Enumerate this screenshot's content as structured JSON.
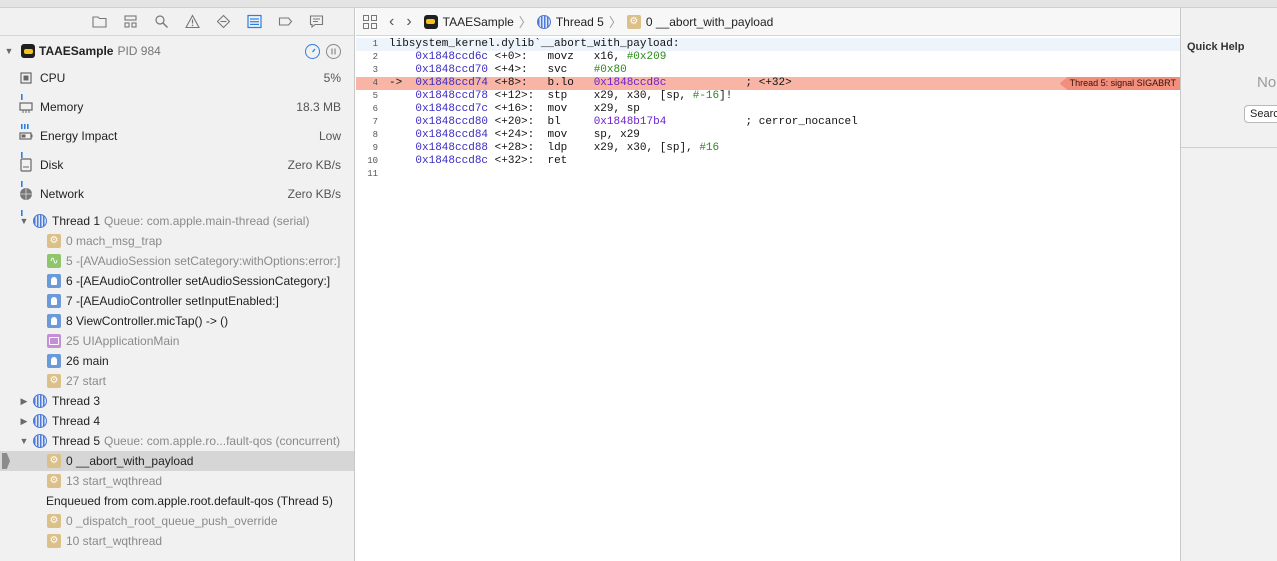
{
  "process": {
    "name": "TAAESample",
    "pid": "PID 984"
  },
  "gauges": [
    {
      "name": "cpu",
      "label": "CPU",
      "value": "5%"
    },
    {
      "name": "memory",
      "label": "Memory",
      "value": "18.3 MB"
    },
    {
      "name": "energy",
      "label": "Energy Impact",
      "value": "Low"
    },
    {
      "name": "disk",
      "label": "Disk",
      "value": "Zero KB/s"
    },
    {
      "name": "network",
      "label": "Network",
      "value": "Zero KB/s"
    }
  ],
  "tree": [
    {
      "kind": "thread",
      "expanded": true,
      "label": "Thread 1",
      "sub": "Queue: com.apple.main-thread (serial)"
    },
    {
      "kind": "frame",
      "icon": "gear",
      "dim": true,
      "label": "0 mach_msg_trap"
    },
    {
      "kind": "frame",
      "icon": "wave",
      "dim": true,
      "label": "5 -[AVAudioSession setCategory:withOptions:error:]"
    },
    {
      "kind": "frame",
      "icon": "user",
      "dim": false,
      "label": "6 -[AEAudioController setAudioSessionCategory:]"
    },
    {
      "kind": "frame",
      "icon": "user",
      "dim": false,
      "label": "7 -[AEAudioController setInputEnabled:]"
    },
    {
      "kind": "frame",
      "icon": "user",
      "dim": false,
      "label": "8 ViewController.micTap() -> ()"
    },
    {
      "kind": "frame",
      "icon": "app",
      "dim": true,
      "label": "25 UIApplicationMain"
    },
    {
      "kind": "frame",
      "icon": "user",
      "dim": false,
      "label": "26 main"
    },
    {
      "kind": "frame",
      "icon": "gear",
      "dim": true,
      "label": "27 start"
    },
    {
      "kind": "thread",
      "expanded": false,
      "label": "Thread 3",
      "sub": ""
    },
    {
      "kind": "thread",
      "expanded": false,
      "label": "Thread 4",
      "sub": ""
    },
    {
      "kind": "thread",
      "expanded": true,
      "label": "Thread 5",
      "sub": "Queue: com.apple.ro...fault-qos (concurrent)"
    },
    {
      "kind": "frame",
      "icon": "gear",
      "dim": false,
      "selected": true,
      "label": "0 __abort_with_payload"
    },
    {
      "kind": "frame",
      "icon": "gear",
      "dim": true,
      "label": "13 start_wqthread"
    },
    {
      "kind": "text",
      "label": "Enqueued from com.apple.root.default-qos (Thread 5)"
    },
    {
      "kind": "frame",
      "icon": "gear",
      "dim": true,
      "label": "0 _dispatch_root_queue_push_override"
    },
    {
      "kind": "frame",
      "icon": "gear",
      "dim": true,
      "label": "10 start_wqthread"
    }
  ],
  "jumpbar": {
    "app": "TAAESample",
    "thread": "Thread 5",
    "frame": "0 __abort_with_payload"
  },
  "code": {
    "header": "libsystem_kernel.dylib`__abort_with_payload:",
    "lines": [
      {
        "n": "1",
        "header": true
      },
      {
        "n": "2",
        "addr": "0x1848ccd6c",
        "off": "<+0>:",
        "op": "movz",
        "args": [
          {
            "t": "x16, "
          },
          {
            "t": "#0x209",
            "c": "num"
          }
        ]
      },
      {
        "n": "3",
        "addr": "0x1848ccd70",
        "off": "<+4>:",
        "op": "svc",
        "args": [
          {
            "t": "#0x80",
            "c": "num"
          }
        ]
      },
      {
        "n": "4",
        "addr": "0x1848ccd74",
        "off": "<+8>:",
        "op": "b.lo",
        "args": [
          {
            "t": "0x1848ccd8c",
            "c": "tgt"
          }
        ],
        "comment": "; <+32>",
        "highlight": true
      },
      {
        "n": "5",
        "addr": "0x1848ccd78",
        "off": "<+12>:",
        "op": "stp",
        "args": [
          {
            "t": "x29, x30, [sp, "
          },
          {
            "t": "#-16",
            "c": "num"
          },
          {
            "t": "]!"
          }
        ]
      },
      {
        "n": "6",
        "addr": "0x1848ccd7c",
        "off": "<+16>:",
        "op": "mov",
        "args": [
          {
            "t": "x29, sp"
          }
        ]
      },
      {
        "n": "7",
        "addr": "0x1848ccd80",
        "off": "<+20>:",
        "op": "bl",
        "args": [
          {
            "t": "0x1848b17b4",
            "c": "tgt"
          }
        ],
        "comment": "; cerror_nocancel"
      },
      {
        "n": "8",
        "addr": "0x1848ccd84",
        "off": "<+24>:",
        "op": "mov",
        "args": [
          {
            "t": "sp, x29"
          }
        ]
      },
      {
        "n": "9",
        "addr": "0x1848ccd88",
        "off": "<+28>:",
        "op": "ldp",
        "args": [
          {
            "t": "x29, x30, [sp], "
          },
          {
            "t": "#16",
            "c": "num"
          }
        ]
      },
      {
        "n": "10",
        "addr": "0x1848ccd8c",
        "off": "<+32>:",
        "op": "ret",
        "args": []
      },
      {
        "n": "11",
        "empty": true
      }
    ],
    "pc_arrow": "->",
    "fault_badge": "Thread 5: signal SIGABRT"
  },
  "quick_help": {
    "title": "Quick Help",
    "no_text": "No",
    "search_label": "Search"
  }
}
